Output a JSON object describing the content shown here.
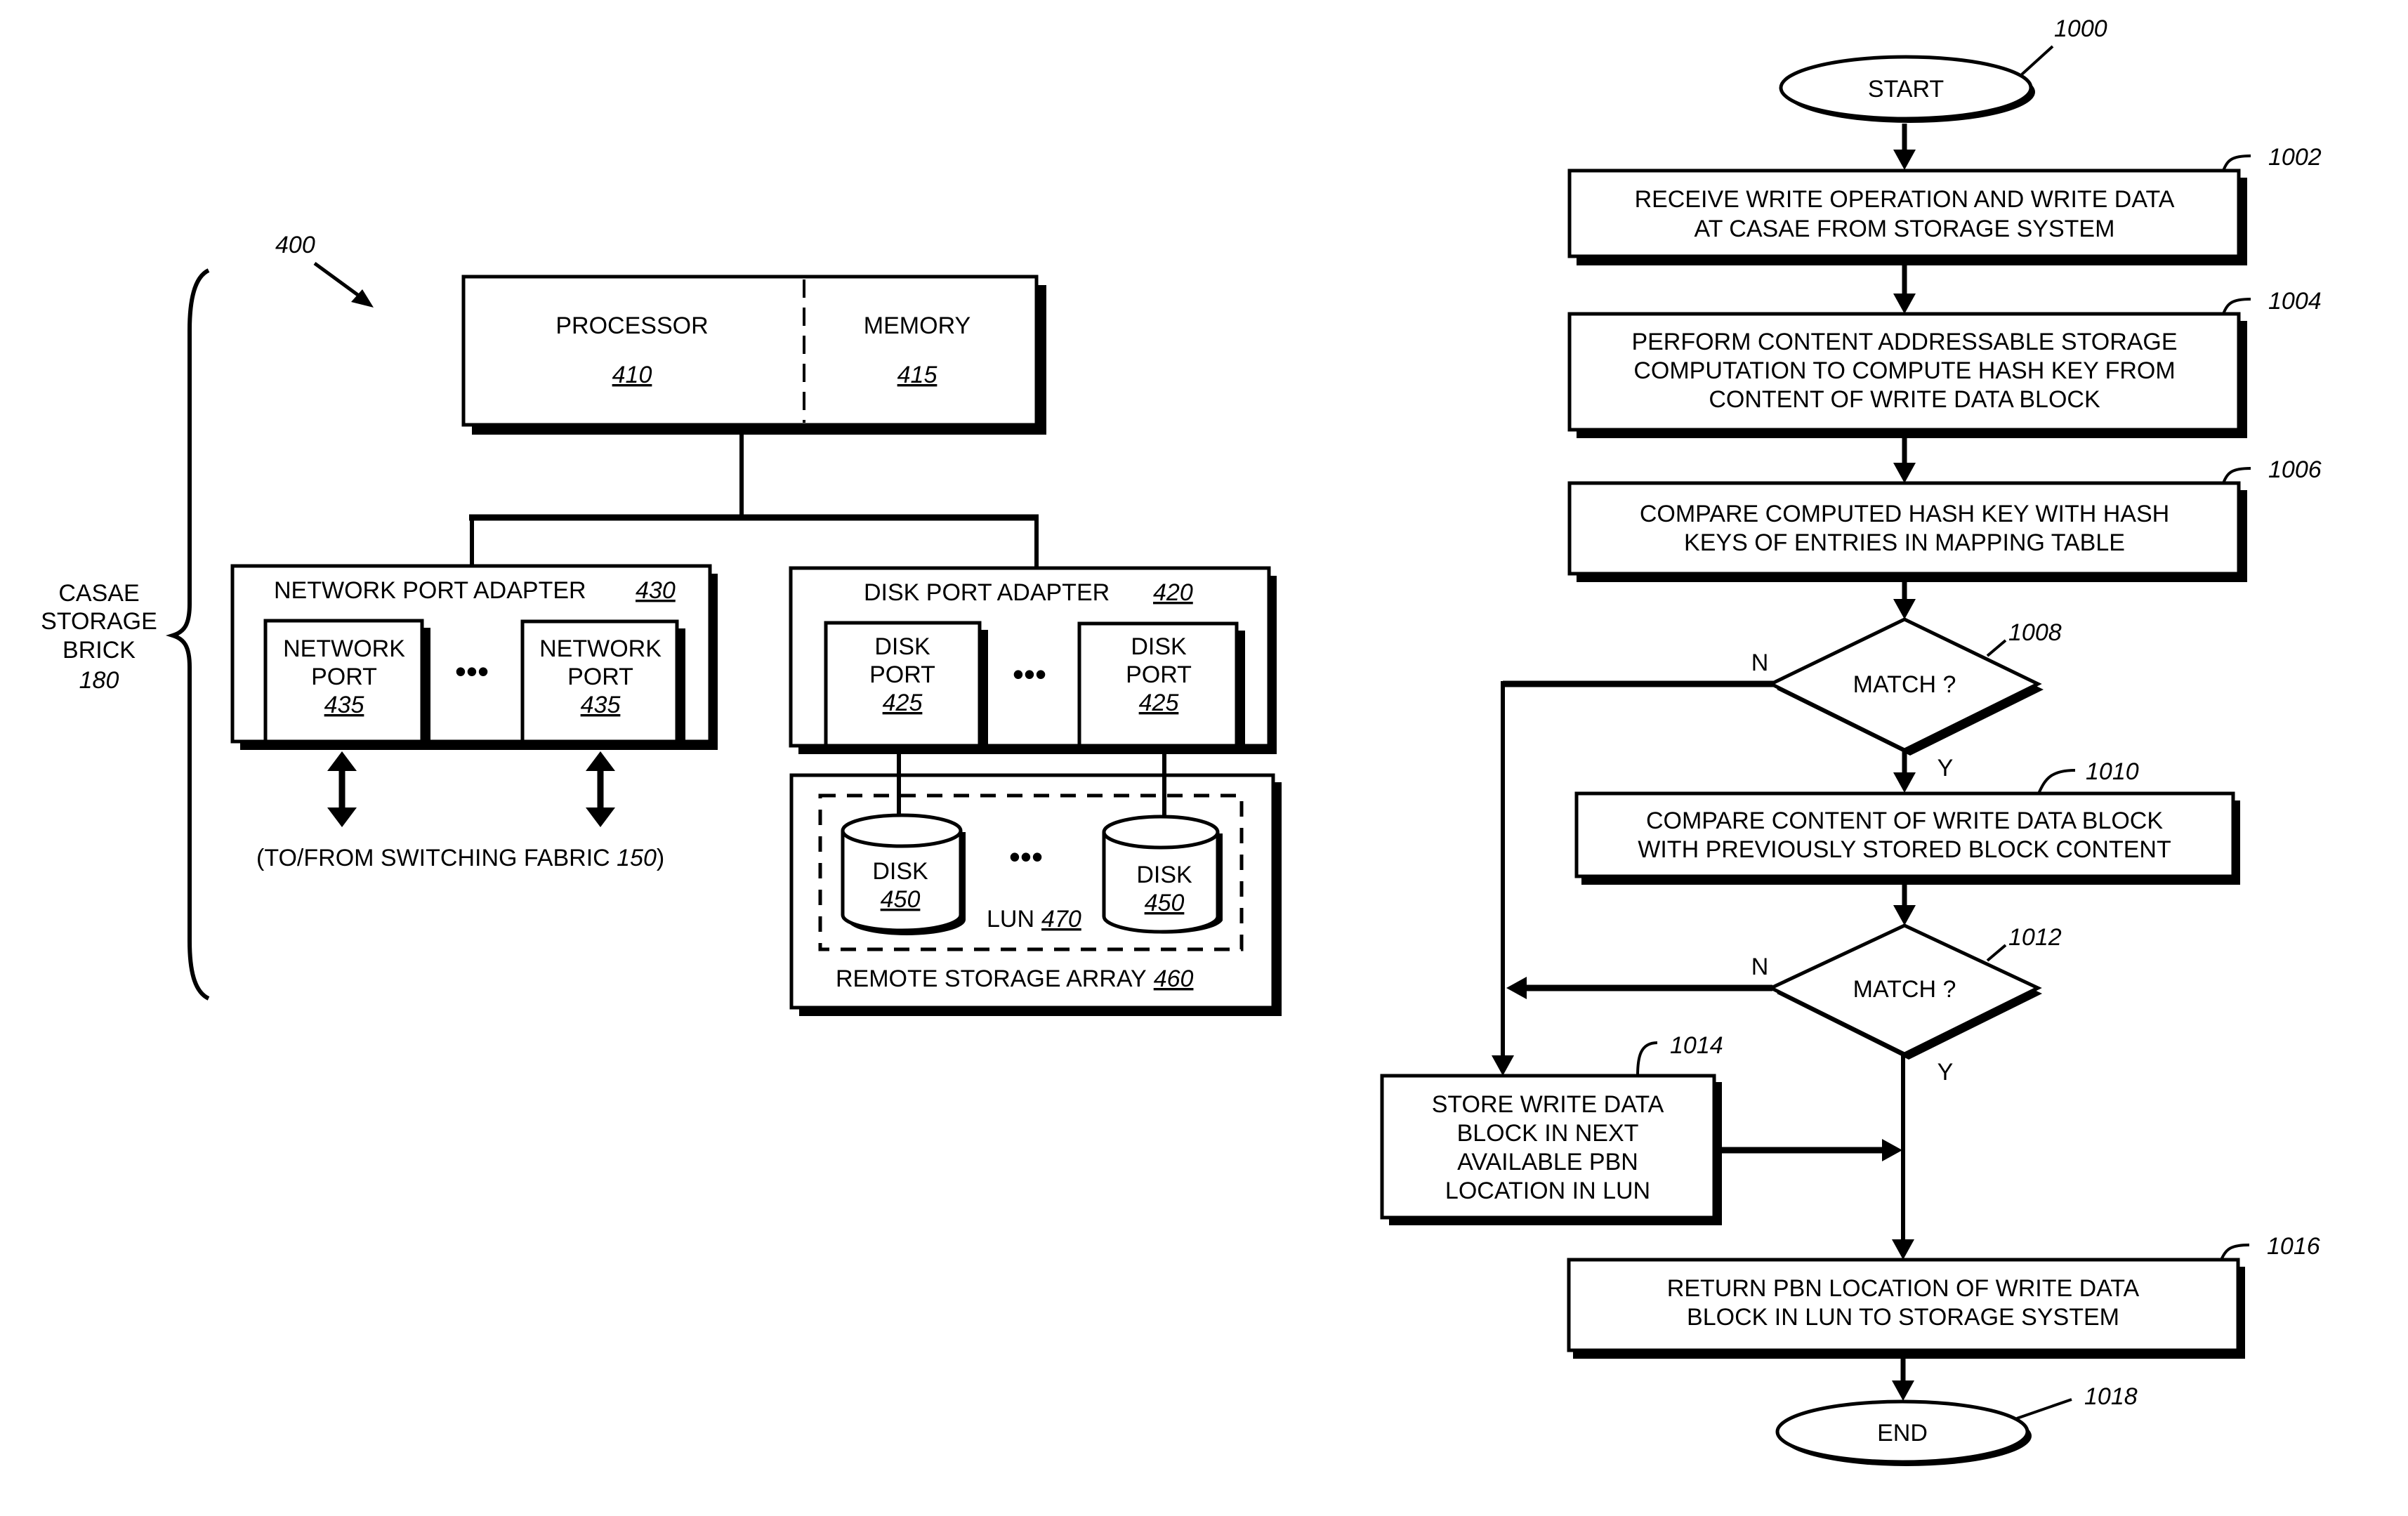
{
  "figure_left": {
    "ref_label": "400",
    "brick_label": [
      "CASAE",
      "STORAGE",
      "BRICK"
    ],
    "brick_ref": "180",
    "processor": {
      "label": "PROCESSOR",
      "ref": "410"
    },
    "memory": {
      "label": "MEMORY",
      "ref": "415"
    },
    "network_port_adapter": {
      "label": "NETWORK PORT ADAPTER",
      "ref": "430"
    },
    "network_ports": [
      {
        "line1": "NETWORK",
        "line2": "PORT",
        "ref": "435"
      },
      {
        "line1": "NETWORK",
        "line2": "PORT",
        "ref": "435"
      }
    ],
    "disk_port_adapter": {
      "label": "DISK PORT ADAPTER",
      "ref": "420"
    },
    "disk_ports": [
      {
        "line1": "DISK",
        "line2": "PORT",
        "ref": "425"
      },
      {
        "line1": "DISK",
        "line2": "PORT",
        "ref": "425"
      }
    ],
    "ellipsis": "•••",
    "switching_fabric": {
      "prefix": "(TO/FROM SWITCHING FABRIC ",
      "ref": "150",
      "suffix": ")"
    },
    "disks": [
      {
        "label": "DISK",
        "ref": "450"
      },
      {
        "label": "DISK",
        "ref": "450"
      }
    ],
    "lun": {
      "label": "LUN",
      "ref": "470"
    },
    "remote_storage_array": {
      "label": "REMOTE STORAGE ARRAY",
      "ref": "460"
    }
  },
  "flowchart": {
    "ref_label": "1000",
    "start": {
      "label": "START"
    },
    "steps": [
      {
        "ref": "1002",
        "lines": [
          "RECEIVE WRITE OPERATION AND WRITE DATA",
          "AT CASAE FROM STORAGE SYSTEM"
        ]
      },
      {
        "ref": "1004",
        "lines": [
          "PERFORM CONTENT ADDRESSABLE STORAGE",
          "COMPUTATION TO COMPUTE HASH KEY FROM",
          "CONTENT OF WRITE DATA BLOCK"
        ]
      },
      {
        "ref": "1006",
        "lines": [
          "COMPARE COMPUTED HASH KEY WITH HASH",
          "KEYS OF ENTRIES IN MAPPING TABLE"
        ]
      },
      {
        "ref": "1010",
        "lines": [
          "COMPARE CONTENT OF WRITE DATA BLOCK",
          "WITH PREVIOUSLY STORED BLOCK CONTENT"
        ]
      },
      {
        "ref": "1014",
        "lines": [
          "STORE WRITE DATA",
          "BLOCK IN NEXT",
          "AVAILABLE PBN",
          "LOCATION IN LUN"
        ]
      },
      {
        "ref": "1016",
        "lines": [
          "RETURN PBN LOCATION OF WRITE DATA",
          "BLOCK IN LUN TO STORAGE SYSTEM"
        ]
      }
    ],
    "decisions": [
      {
        "ref": "1008",
        "label": "MATCH ?",
        "no": "N",
        "yes": "Y"
      },
      {
        "ref": "1012",
        "label": "MATCH ?",
        "no": "N",
        "yes": "Y"
      }
    ],
    "end": {
      "ref": "1018",
      "label": "END"
    }
  }
}
